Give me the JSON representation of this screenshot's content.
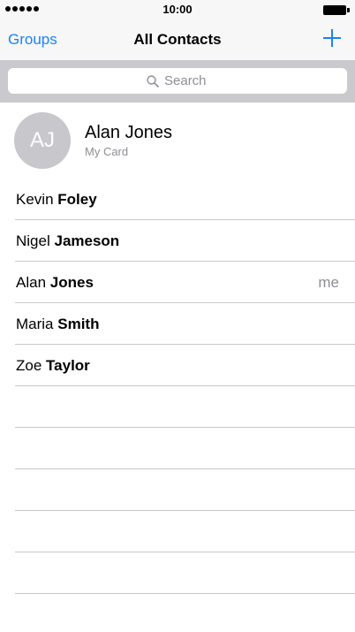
{
  "status_bar": {
    "time": "10:00",
    "signal_dots": 5
  },
  "nav": {
    "left_label": "Groups",
    "title": "All Contacts",
    "add_icon": "plus-icon"
  },
  "search": {
    "placeholder": "Search",
    "value": ""
  },
  "my_card": {
    "initials": "AJ",
    "name": "Alan Jones",
    "subtitle": "My Card"
  },
  "contacts": [
    {
      "first": "Kevin",
      "last": "Foley",
      "badge": ""
    },
    {
      "first": "Nigel",
      "last": "Jameson",
      "badge": ""
    },
    {
      "first": "Alan",
      "last": "Jones",
      "badge": "me"
    },
    {
      "first": "Maria",
      "last": "Smith",
      "badge": ""
    },
    {
      "first": "Zoe",
      "last": "Taylor",
      "badge": ""
    }
  ],
  "colors": {
    "accent": "#1a82fb",
    "bar_bg": "#f7f7f7",
    "search_bg": "#c9c9ce",
    "separator": "#c8c7cc",
    "secondary_text": "#8e8e93",
    "avatar_bg": "#c7c7cc"
  }
}
